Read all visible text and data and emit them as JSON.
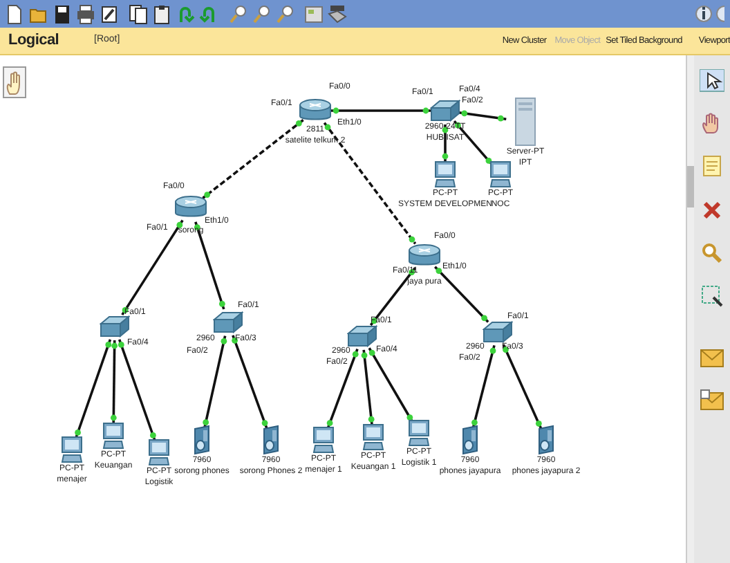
{
  "workspace_bar": {
    "view": "Logical",
    "path": "[Root]",
    "actions": [
      {
        "label": "New Cluster",
        "disabled": false
      },
      {
        "label": "Move Object",
        "disabled": true
      },
      {
        "label": "Set Tiled Background",
        "disabled": false
      },
      {
        "label": "Viewport",
        "disabled": false
      }
    ]
  },
  "devices": [
    {
      "kind": "router",
      "model": "2811",
      "name": "satelite telkum 2",
      "ports": [
        "Fa0/1",
        "Fa0/0",
        "Eth1/0"
      ]
    },
    {
      "kind": "switch",
      "model": "2960-24TT",
      "name": "HUB ISAT",
      "ports": [
        "Fa0/1",
        "Fa0/4",
        "Fa0/2"
      ]
    },
    {
      "kind": "server",
      "model": "Server-PT",
      "name": "IPT"
    },
    {
      "kind": "pc",
      "model": "PC-PT",
      "name": "SYSTEM DEVELOPMEN"
    },
    {
      "kind": "pc",
      "model": "PC-PT",
      "name": "NOC"
    },
    {
      "kind": "router",
      "name": "sorong",
      "ports": [
        "Fa0/0",
        "Fa0/1",
        "Eth1/0"
      ]
    },
    {
      "kind": "router",
      "name": "jaya pura",
      "ports": [
        "Fa0/0",
        "Fa0/11",
        "Eth1/0"
      ]
    },
    {
      "kind": "switch",
      "ports": [
        "Fa0/1",
        "Fa0/4"
      ]
    },
    {
      "kind": "switch",
      "model": "2960",
      "ports": [
        "Fa0/1",
        "Fa0/3",
        "Fa0/2"
      ]
    },
    {
      "kind": "switch",
      "model": "2960",
      "ports": [
        "Fa0/1",
        "Fa0/4",
        "Fa0/2"
      ]
    },
    {
      "kind": "switch",
      "model": "2960",
      "ports": [
        "Fa0/1",
        "Fa0/3",
        "Fa0/2"
      ]
    },
    {
      "kind": "pc",
      "model": "PC-PT",
      "name": "menajer"
    },
    {
      "kind": "pc",
      "model": "PC-PT",
      "name": "Keuangan"
    },
    {
      "kind": "pc",
      "model": "PC-PT",
      "name": "Logistik"
    },
    {
      "kind": "phone",
      "model": "7960",
      "name": "sorong phones"
    },
    {
      "kind": "phone",
      "model": "7960",
      "name": "sorong Phones 2"
    },
    {
      "kind": "pc",
      "model": "PC-PT",
      "name": "menajer 1"
    },
    {
      "kind": "pc",
      "model": "PC-PT",
      "name": "Keuangan 1"
    },
    {
      "kind": "pc",
      "model": "PC-PT",
      "name": "Logistik 1"
    },
    {
      "kind": "phone",
      "model": "7960",
      "name": "phones jayapura"
    },
    {
      "kind": "phone",
      "model": "7960",
      "name": "phones jayapura 2"
    }
  ]
}
